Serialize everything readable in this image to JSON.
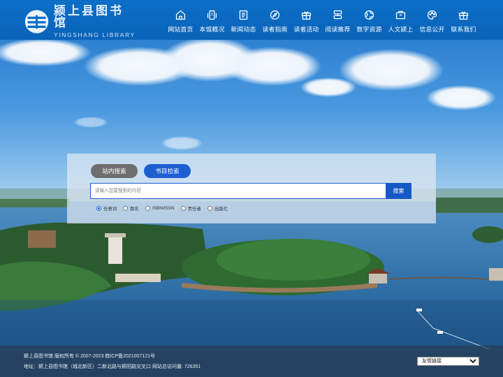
{
  "header": {
    "logo_cn": "颍上县图书馆",
    "logo_en": "YINGSHANG LIBRARY",
    "nav": [
      {
        "label": "网站首页",
        "icon": "home-icon"
      },
      {
        "label": "本馆概况",
        "icon": "building-icon"
      },
      {
        "label": "新闻动态",
        "icon": "news-icon"
      },
      {
        "label": "读者指南",
        "icon": "compass-icon"
      },
      {
        "label": "读者活动",
        "icon": "gift-icon"
      },
      {
        "label": "阅读推荐",
        "icon": "books-icon"
      },
      {
        "label": "数字资源",
        "icon": "globe-icon"
      },
      {
        "label": "人文颍上",
        "icon": "briefcase-icon"
      },
      {
        "label": "信息公开",
        "icon": "palette-icon"
      },
      {
        "label": "联系我们",
        "icon": "gift-box-icon"
      }
    ]
  },
  "search": {
    "tab_site": "站内搜索",
    "tab_catalog": "书目检索",
    "active_tab": "tab_catalog",
    "placeholder": "请输入您要搜索的内容",
    "value": "",
    "button": "搜索",
    "options": [
      {
        "label": "任意词",
        "checked": true
      },
      {
        "label": "题名",
        "checked": false
      },
      {
        "label": "ISBN/ISSN",
        "checked": false
      },
      {
        "label": "责任者",
        "checked": false
      },
      {
        "label": "出版社",
        "checked": false
      }
    ]
  },
  "footer": {
    "copyright": "颍上县图书馆 版权所有 © 2007-2023 皖ICP备2021007121号",
    "address": "地址：颍上县图书馆（城北新区）二新北路与颍阳路交叉口 网站总访问量: 726351",
    "links_select": "友情链接"
  },
  "colors": {
    "header_blue": "#0b6fc8",
    "accent_blue": "#1d5fd1",
    "tab_gray": "#6e6e6e"
  }
}
